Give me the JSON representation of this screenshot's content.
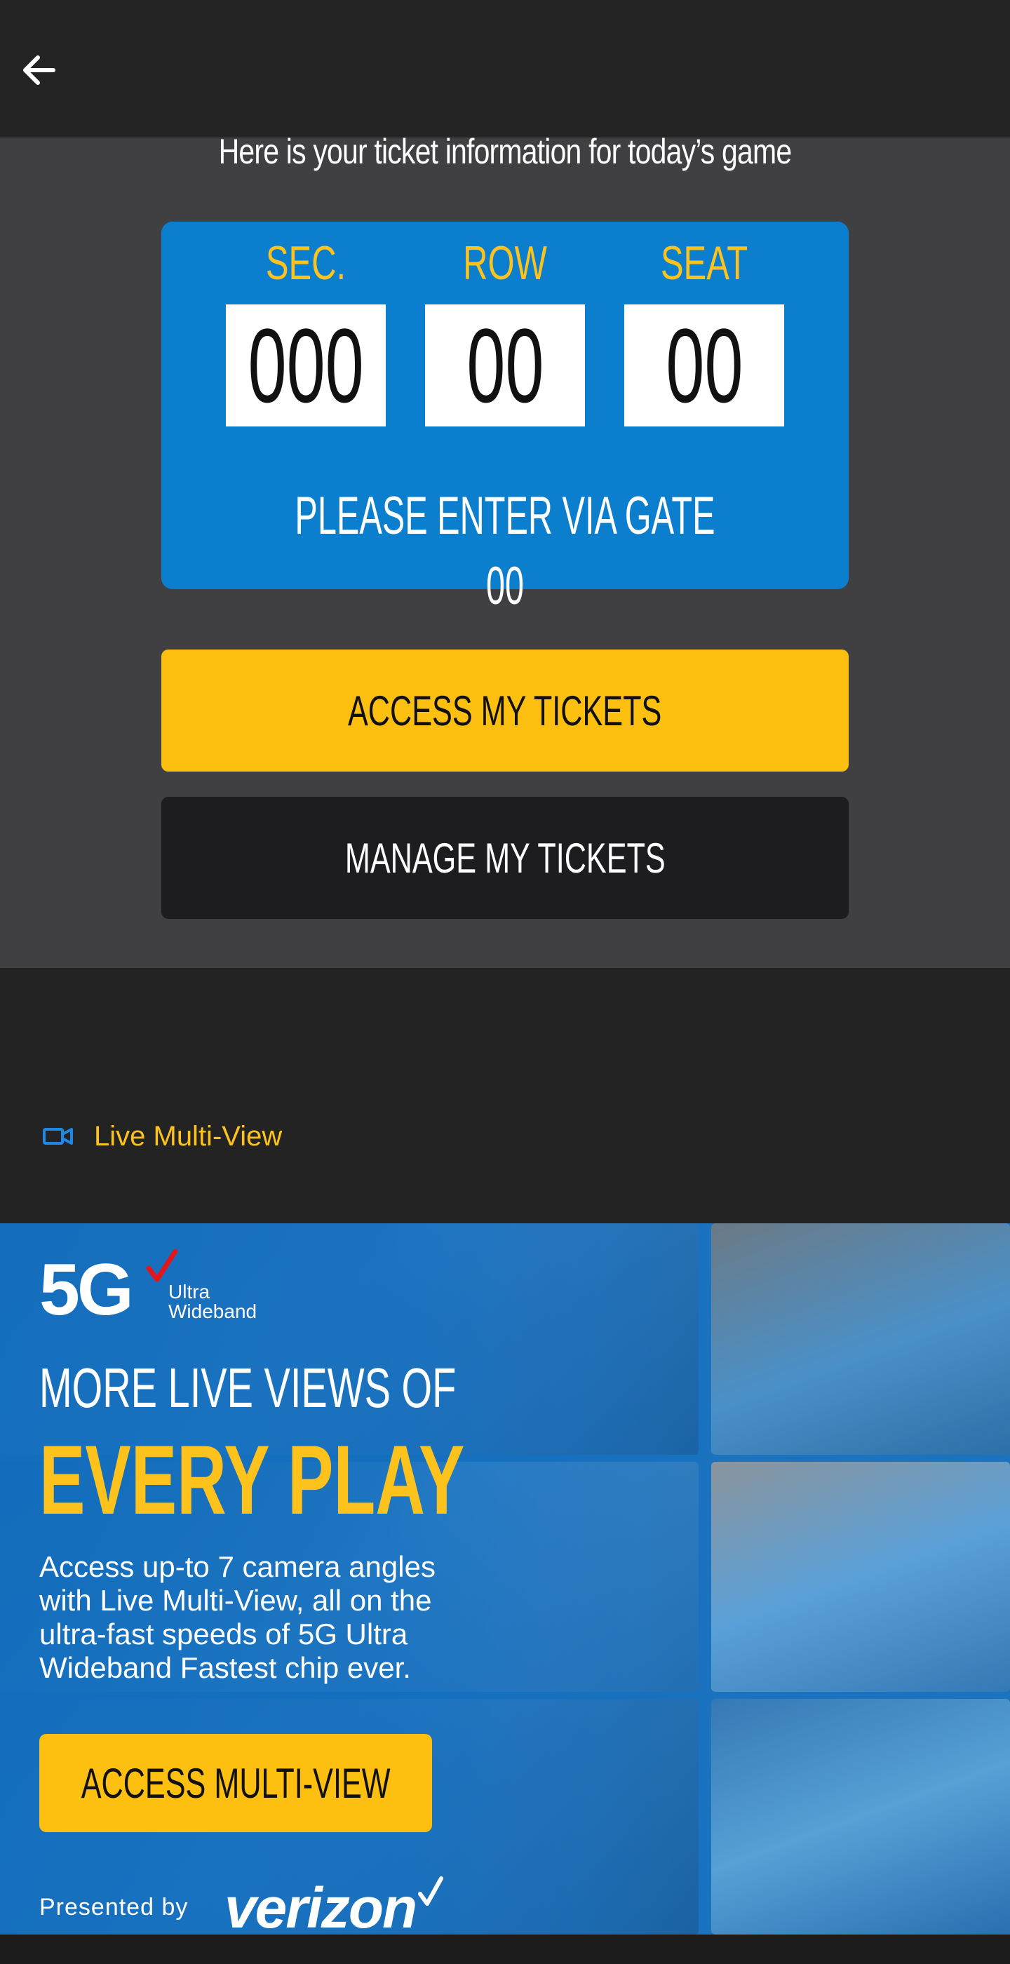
{
  "header": {
    "back_icon": "arrow-left-icon"
  },
  "ticket": {
    "intro": "Here is your ticket information for today’s game",
    "labels": {
      "section": "SEC.",
      "row": "ROW",
      "seat": "SEAT"
    },
    "values": {
      "section": "000",
      "row": "00",
      "seat": "00"
    },
    "gate_text": "PLEASE ENTER VIA GATE 00",
    "access_button": "ACCESS MY TICKETS",
    "manage_button": "MANAGE MY TICKETS"
  },
  "multiview": {
    "icon": "video-camera-icon",
    "label": "Live Multi-View"
  },
  "promo": {
    "logo_5g": "5G",
    "logo_line1": "Ultra",
    "logo_line2": "Wideband",
    "subtitle": "MORE LIVE VIEWS OF",
    "headline": "EVERY PLAY",
    "description": "Access up-to 7 camera angles with Live Multi-View, all on the ultra-fast speeds of 5G Ultra Wideband Fastest chip ever.",
    "button": "ACCESS MULTI-VIEW",
    "presented_by": "Presented by",
    "sponsor": "verizon"
  },
  "colors": {
    "accent_yellow": "#fdc010",
    "ticket_blue": "#0b7fcd",
    "dark_bg": "#232323",
    "section_bg": "#404042"
  }
}
